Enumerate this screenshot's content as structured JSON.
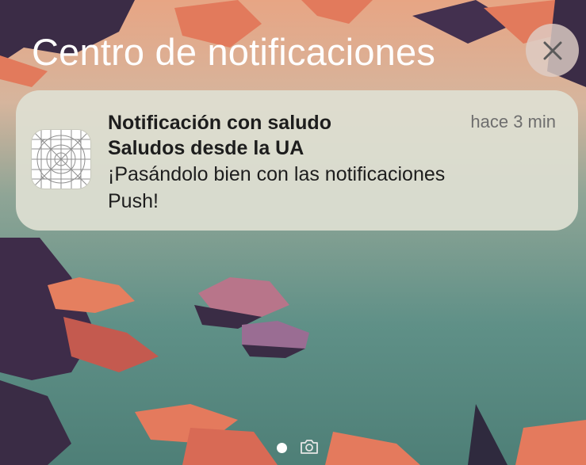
{
  "header": {
    "title": "Centro de notificaciones"
  },
  "notification": {
    "title": "Notificación con saludo",
    "subtitle": "Saludos desde la UA",
    "body": "¡Pasándolo bien con las notificaciones Push!",
    "time": "hace 3 min"
  },
  "icons": {
    "close": "close-icon",
    "app": "app-placeholder-icon",
    "camera": "camera-icon"
  },
  "colors": {
    "card_background": "#dedfd2",
    "title_text": "#ffffff",
    "time_text": "#6e6e6e"
  }
}
